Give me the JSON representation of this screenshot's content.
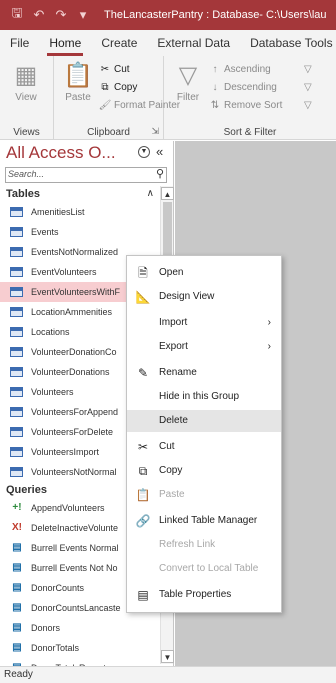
{
  "titlebar": {
    "title": "TheLancasterPantry : Database- C:\\Users\\lau",
    "icons": [
      "save-icon",
      "undo-icon",
      "redo-icon",
      "customize-quick-access-icon"
    ]
  },
  "ribbon_tabs": [
    "File",
    "Home",
    "Create",
    "External Data",
    "Database Tools"
  ],
  "ribbon": {
    "views": {
      "view_label": "View",
      "group_label": "Views"
    },
    "clipboard": {
      "paste_label": "Paste",
      "cut_label": "Cut",
      "copy_label": "Copy",
      "format_painter_label": "Format Painter",
      "group_label": "Clipboard"
    },
    "sort_filter": {
      "filter_label": "Filter",
      "ascending_label": "Ascending",
      "descending_label": "Descending",
      "remove_sort_label": "Remove Sort",
      "group_label": "Sort & Filter"
    }
  },
  "nav": {
    "title": "All Access O...",
    "search_placeholder": "Search...",
    "tables_header": "Tables",
    "tables": [
      "AmenitiesList",
      "Events",
      "EventsNotNormalized",
      "EventVolunteers",
      "EventVolunteersWithF",
      "LocationAmmenities",
      "Locations",
      "VolunteerDonationCo",
      "VolunteerDonations",
      "Volunteers",
      "VolunteersForAppend",
      "VolunteersForDelete",
      "VolunteersImport",
      "VolunteersNotNormal"
    ],
    "selected_table": "EventVolunteersWithF",
    "queries_header": "Queries",
    "queries": [
      {
        "label": "AppendVolunteers",
        "icon": "append-query-icon"
      },
      {
        "label": "DeleteInactiveVolunte",
        "icon": "delete-query-icon"
      },
      {
        "label": "Burrell Events Normal",
        "icon": "select-query-icon"
      },
      {
        "label": "Burrell Events Not No",
        "icon": "select-query-icon"
      },
      {
        "label": "DonorCounts",
        "icon": "select-query-icon"
      },
      {
        "label": "DonorCountsLancaste",
        "icon": "select-query-icon"
      },
      {
        "label": "Donors",
        "icon": "select-query-icon"
      },
      {
        "label": "DonorTotals",
        "icon": "select-query-icon"
      },
      {
        "label": "DonorTotalsReport",
        "icon": "select-query-icon"
      }
    ]
  },
  "context_menu": {
    "items": [
      {
        "label": "Open",
        "icon": "open-icon",
        "enabled": true
      },
      {
        "label": "Design View",
        "icon": "design-view-icon",
        "enabled": true
      },
      {
        "label": "Import",
        "icon": "",
        "enabled": true,
        "submenu": true
      },
      {
        "label": "Export",
        "icon": "",
        "enabled": true,
        "submenu": true
      },
      {
        "label": "Rename",
        "icon": "rename-icon",
        "enabled": true
      },
      {
        "label": "Hide in this Group",
        "icon": "",
        "enabled": true
      },
      {
        "label": "Delete",
        "icon": "",
        "enabled": true,
        "highlighted": true
      },
      {
        "label": "Cut",
        "icon": "cut-icon",
        "enabled": true
      },
      {
        "label": "Copy",
        "icon": "copy-icon",
        "enabled": true
      },
      {
        "label": "Paste",
        "icon": "paste-icon",
        "enabled": false
      },
      {
        "label": "Linked Table Manager",
        "icon": "linked-table-manager-icon",
        "enabled": true
      },
      {
        "label": "Refresh Link",
        "icon": "",
        "enabled": false
      },
      {
        "label": "Convert to Local Table",
        "icon": "",
        "enabled": false
      },
      {
        "label": "Table Properties",
        "icon": "table-properties-icon",
        "enabled": true
      }
    ]
  },
  "status": {
    "text": "Ready"
  },
  "colors": {
    "accent": "#a4373a",
    "selection": "#f7cdd0",
    "workspace": "#c8c8c8"
  }
}
